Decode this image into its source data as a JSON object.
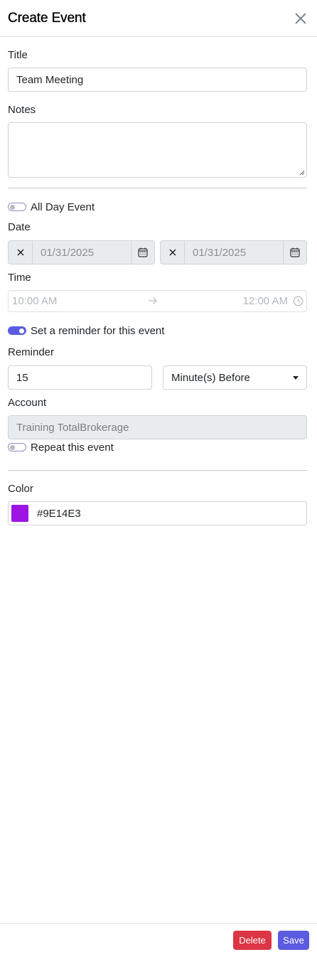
{
  "header": {
    "title": "Create Event"
  },
  "title_field": {
    "label": "Title",
    "value": "Team Meeting"
  },
  "notes_field": {
    "label": "Notes",
    "value": ""
  },
  "all_day": {
    "label": "All Day Event",
    "checked": false
  },
  "date": {
    "label": "Date",
    "start": "01/31/2025",
    "end": "01/31/2025"
  },
  "time": {
    "label": "Time",
    "start": "10:00 AM",
    "end": "12:00 AM"
  },
  "reminder_toggle": {
    "label": "Set a reminder for this event",
    "checked": true
  },
  "reminder": {
    "label": "Reminder",
    "amount": "15",
    "unit": "Minute(s) Before"
  },
  "account": {
    "label": "Account",
    "value": "Training TotalBrokerage"
  },
  "repeat": {
    "label": "Repeat this event",
    "checked": false
  },
  "color": {
    "label": "Color",
    "value": "#9E14E3",
    "swatch": "#9E14E3"
  },
  "footer": {
    "delete_label": "Delete",
    "save_label": "Save"
  },
  "theme": {
    "accent": "#5b5ce0",
    "danger": "#dc3545"
  }
}
